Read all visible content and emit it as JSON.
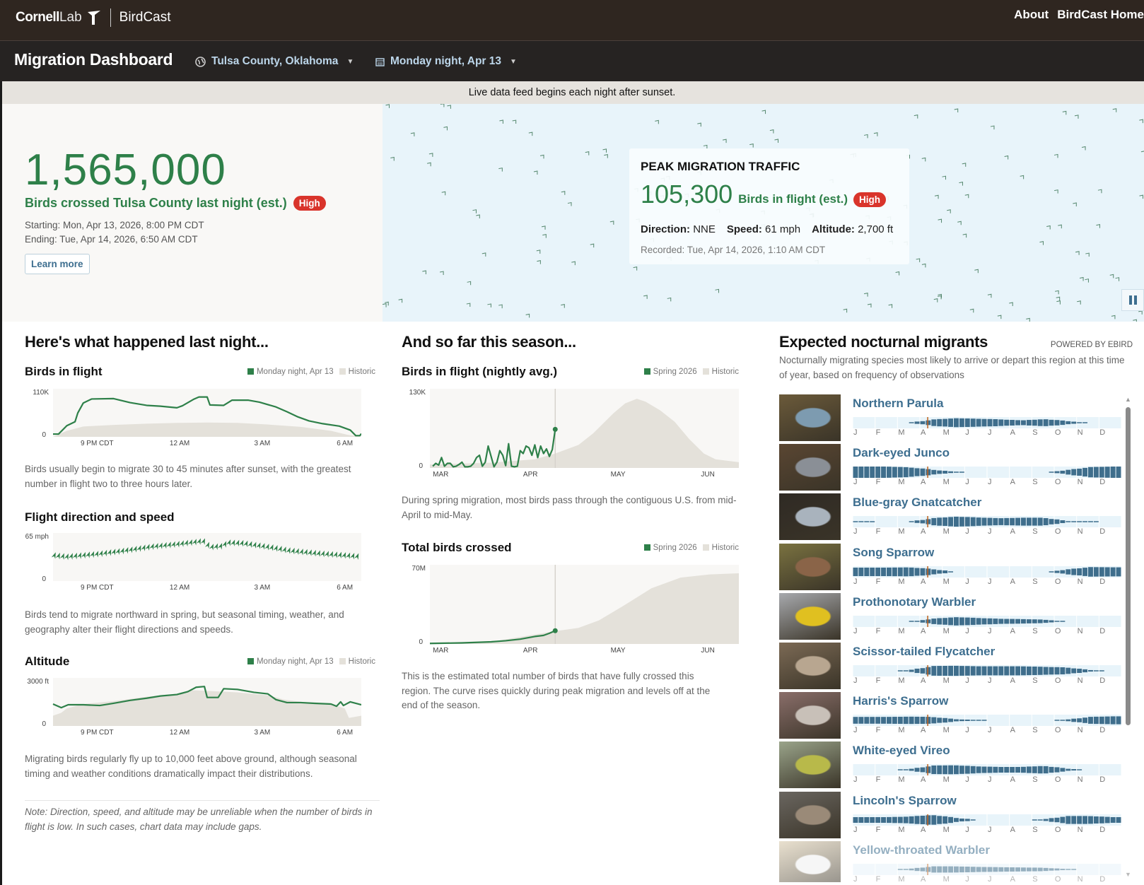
{
  "header": {
    "logo_cornell": "Cornell",
    "logo_lab": "Lab",
    "logo_birdcast": "BirdCast",
    "nav": [
      "About",
      "BirdCast Home"
    ]
  },
  "dashboard": {
    "title": "Migration Dashboard",
    "location": "Tulsa County, Oklahoma",
    "date": "Monday night, Apr 13"
  },
  "notice": "Live data feed begins each night after sunset.",
  "hero": {
    "total": "1,565,000",
    "label": "Birds crossed Tulsa County last night (est.)",
    "badge": "High",
    "starting": "Starting: Mon, Apr 13, 2026, 8:00 PM CDT",
    "ending": "Ending: Tue, Apr 14, 2026, 6:50 AM CDT",
    "learn_more": "Learn more"
  },
  "peak": {
    "title": "PEAK MIGRATION TRAFFIC",
    "number": "105,300",
    "label": "Birds in flight (est.)",
    "badge": "High",
    "direction_label": "Direction:",
    "direction": "NNE",
    "speed_label": "Speed:",
    "speed": "61 mph",
    "altitude_label": "Altitude:",
    "altitude": "2,700 ft",
    "recorded": "Recorded: Tue, Apr 14, 2026, 1:10 AM CDT"
  },
  "colors": {
    "green": "#2e8049",
    "historic": "#e4e1da",
    "badge": "#d9342b",
    "species": "#3d6e8f",
    "bar": "#3f6e8c"
  },
  "last_night": {
    "heading": "Here's what happened last night...",
    "legend_current": "Monday night, Apr 13",
    "legend_historic": "Historic",
    "note": "Note: Direction, speed, and altitude may be unreliable when the number of birds in flight is low. In such cases, chart data may include gaps."
  },
  "season": {
    "heading": "And so far this season...",
    "legend_current": "Spring 2026",
    "legend_historic": "Historic"
  },
  "chart_data": [
    {
      "id": "birds-in-flight",
      "type": "area",
      "title": "Birds in flight",
      "ylabel_top": "110K",
      "ylabel_zero": "0",
      "ylim": [
        0,
        110
      ],
      "xlim": [
        19.4,
        30.6
      ],
      "x_ticks": [
        {
          "x": 21,
          "label": "9 PM CDT"
        },
        {
          "x": 24,
          "label": "12 AM"
        },
        {
          "x": 27,
          "label": "3 AM"
        },
        {
          "x": 30,
          "label": "6 AM"
        }
      ],
      "description": "Birds usually begin to migrate 30 to 45 minutes after sunset, with the greatest number in flight two to three hours later.",
      "historic": [
        [
          19.4,
          0
        ],
        [
          19.9,
          15
        ],
        [
          20.5,
          26
        ],
        [
          21.6,
          30
        ],
        [
          22.8,
          33
        ],
        [
          23.9,
          35
        ],
        [
          25,
          36
        ],
        [
          26.1,
          35
        ],
        [
          27.2,
          31
        ],
        [
          28.4,
          25
        ],
        [
          29.5,
          15
        ],
        [
          30.1,
          5
        ],
        [
          30.6,
          0
        ]
      ],
      "current": [
        [
          19.4,
          7
        ],
        [
          19.6,
          7
        ],
        [
          19.9,
          28
        ],
        [
          20.2,
          38
        ],
        [
          20.3,
          60
        ],
        [
          20.5,
          85
        ],
        [
          20.8,
          95
        ],
        [
          21.6,
          96
        ],
        [
          22.2,
          86
        ],
        [
          22.8,
          79
        ],
        [
          23.3,
          77
        ],
        [
          23.9,
          73
        ],
        [
          24.1,
          78
        ],
        [
          24.5,
          94
        ],
        [
          24.7,
          100
        ],
        [
          25,
          100
        ],
        [
          25.1,
          80
        ],
        [
          25.6,
          79
        ],
        [
          25.9,
          92
        ],
        [
          26.5,
          92
        ],
        [
          26.9,
          87
        ],
        [
          27.5,
          75
        ],
        [
          27.9,
          63
        ],
        [
          28.3,
          50
        ],
        [
          28.7,
          40
        ],
        [
          29.2,
          33
        ],
        [
          29.8,
          27
        ],
        [
          30.2,
          17
        ],
        [
          30.4,
          3
        ],
        [
          30.55,
          3
        ],
        [
          30.6,
          8
        ]
      ]
    },
    {
      "id": "flight-speed",
      "type": "line",
      "title": "Flight direction and speed",
      "ylabel_top": "65 mph",
      "ylabel_zero": "0",
      "ylim": [
        0,
        65
      ],
      "xlim": [
        19.4,
        30.6
      ],
      "direction_deg": 22,
      "x_ticks": [
        {
          "x": 21,
          "label": "9 PM CDT"
        },
        {
          "x": 24,
          "label": "12 AM"
        },
        {
          "x": 27,
          "label": "3 AM"
        },
        {
          "x": 30,
          "label": "6 AM"
        }
      ],
      "description": "Birds tend to migrate northward in spring, but seasonal timing, weather, and geography alter their flight directions and speeds.",
      "current": [
        [
          19.4,
          38
        ],
        [
          19.9,
          36
        ],
        [
          21,
          40
        ],
        [
          22,
          45
        ],
        [
          23,
          51
        ],
        [
          24,
          55
        ],
        [
          24.8,
          59
        ],
        [
          25,
          58
        ],
        [
          25.05,
          50
        ],
        [
          25.6,
          52
        ],
        [
          25.7,
          57
        ],
        [
          26.3,
          56
        ],
        [
          27.3,
          50
        ],
        [
          28,
          45
        ],
        [
          29,
          41
        ],
        [
          30,
          38
        ],
        [
          30.6,
          36
        ]
      ]
    },
    {
      "id": "altitude",
      "type": "area",
      "title": "Altitude",
      "ylabel_top": "3000 ft",
      "ylabel_zero": "0",
      "ylim": [
        0,
        3000
      ],
      "xlim": [
        19.4,
        30.6
      ],
      "x_ticks": [
        {
          "x": 21,
          "label": "9 PM CDT"
        },
        {
          "x": 24,
          "label": "12 AM"
        },
        {
          "x": 27,
          "label": "3 AM"
        },
        {
          "x": 30,
          "label": "6 AM"
        }
      ],
      "description": "Migrating birds regularly fly up to 10,000 feet above ground, although seasonal timing and weather conditions dramatically impact their distributions.",
      "historic": [
        [
          19.4,
          700
        ],
        [
          19.7,
          900
        ],
        [
          19.9,
          1200
        ],
        [
          20.5,
          1500
        ],
        [
          21.6,
          1700
        ],
        [
          22.8,
          2000
        ],
        [
          23.9,
          2200
        ],
        [
          24.4,
          2450
        ],
        [
          25,
          2400
        ],
        [
          26.1,
          2300
        ],
        [
          27.2,
          2100
        ],
        [
          27.8,
          1800
        ],
        [
          28.4,
          1650
        ],
        [
          29.5,
          1500
        ],
        [
          30,
          1200
        ],
        [
          30.15,
          550
        ],
        [
          30.6,
          700
        ]
      ],
      "current": [
        [
          19.4,
          1500
        ],
        [
          19.7,
          1250
        ],
        [
          19.95,
          1450
        ],
        [
          20.5,
          1450
        ],
        [
          21.1,
          1400
        ],
        [
          21.6,
          1550
        ],
        [
          22.2,
          1750
        ],
        [
          22.8,
          1900
        ],
        [
          23.3,
          2050
        ],
        [
          23.9,
          2150
        ],
        [
          24.3,
          2350
        ],
        [
          24.6,
          2650
        ],
        [
          24.9,
          2700
        ],
        [
          25,
          1950
        ],
        [
          25.4,
          1950
        ],
        [
          25.6,
          2550
        ],
        [
          26.1,
          2500
        ],
        [
          26.7,
          2300
        ],
        [
          27.2,
          2200
        ],
        [
          27.5,
          1800
        ],
        [
          27.9,
          1600
        ],
        [
          28.4,
          1600
        ],
        [
          28.9,
          1550
        ],
        [
          29.5,
          1500
        ],
        [
          29.7,
          1350
        ],
        [
          29.85,
          1650
        ],
        [
          29.95,
          1400
        ],
        [
          30.2,
          1650
        ],
        [
          30.6,
          1450
        ]
      ]
    },
    {
      "id": "nightly-avg",
      "type": "area",
      "title": "Birds in flight (nightly avg.)",
      "ylabel_top": "130K",
      "ylabel_zero": "0",
      "ylim": [
        0,
        130
      ],
      "xlim": [
        -1,
        105
      ],
      "current_day": 42,
      "x_ticks": [
        {
          "x": 0,
          "label": "MAR"
        },
        {
          "x": 31,
          "label": "APR"
        },
        {
          "x": 61,
          "label": "MAY"
        },
        {
          "x": 92,
          "label": "JUN"
        }
      ],
      "description": "During spring migration, most birds pass through the contiguous U.S. from mid-April to mid-May.",
      "historic": [
        [
          -1,
          6
        ],
        [
          20,
          9
        ],
        [
          35,
          15
        ],
        [
          42,
          25
        ],
        [
          50,
          40
        ],
        [
          55,
          60
        ],
        [
          62,
          95
        ],
        [
          66,
          112
        ],
        [
          70,
          120
        ],
        [
          73,
          115
        ],
        [
          78,
          100
        ],
        [
          83,
          80
        ],
        [
          88,
          50
        ],
        [
          93,
          25
        ],
        [
          97,
          15
        ],
        [
          105,
          10
        ]
      ],
      "current": [
        [
          0,
          3
        ],
        [
          1,
          8
        ],
        [
          2,
          5
        ],
        [
          3,
          18
        ],
        [
          4,
          3
        ],
        [
          5,
          8
        ],
        [
          6,
          8
        ],
        [
          7,
          2
        ],
        [
          8,
          3
        ],
        [
          9,
          6
        ],
        [
          10,
          10
        ],
        [
          11,
          2
        ],
        [
          12,
          2
        ],
        [
          13,
          3
        ],
        [
          14,
          8
        ],
        [
          15,
          18
        ],
        [
          16,
          22
        ],
        [
          17,
          3
        ],
        [
          18,
          10
        ],
        [
          19,
          38
        ],
        [
          20,
          20
        ],
        [
          21,
          2
        ],
        [
          22,
          10
        ],
        [
          23,
          30
        ],
        [
          24,
          22
        ],
        [
          25,
          4
        ],
        [
          26,
          42
        ],
        [
          27,
          3
        ],
        [
          28,
          2
        ],
        [
          29,
          3
        ],
        [
          30,
          30
        ],
        [
          31,
          25
        ],
        [
          32,
          38
        ],
        [
          33,
          35
        ],
        [
          34,
          22
        ],
        [
          35,
          40
        ],
        [
          36,
          18
        ],
        [
          37,
          38
        ],
        [
          38,
          25
        ],
        [
          39,
          33
        ],
        [
          40,
          20
        ],
        [
          41,
          32
        ],
        [
          42,
          67
        ]
      ]
    },
    {
      "id": "total-crossed",
      "type": "area",
      "title": "Total birds crossed",
      "ylabel_top": "70M",
      "ylabel_zero": "0",
      "ylim": [
        0,
        70
      ],
      "xlim": [
        -1,
        105
      ],
      "current_day": 42,
      "x_ticks": [
        {
          "x": 0,
          "label": "MAR"
        },
        {
          "x": 31,
          "label": "APR"
        },
        {
          "x": 61,
          "label": "MAY"
        },
        {
          "x": 92,
          "label": "JUN"
        }
      ],
      "description": "This is the estimated total number of birds that have fully crossed this region. The curve rises quickly during peak migration and levels off at the end of the season.",
      "historic": [
        [
          -1,
          0.5
        ],
        [
          20,
          2
        ],
        [
          42,
          12
        ],
        [
          50,
          15
        ],
        [
          57,
          22
        ],
        [
          65,
          35
        ],
        [
          75,
          52
        ],
        [
          85,
          62
        ],
        [
          95,
          65
        ],
        [
          105,
          66
        ]
      ],
      "current": [
        [
          -1,
          0.5
        ],
        [
          10,
          1
        ],
        [
          20,
          2
        ],
        [
          25,
          3
        ],
        [
          30,
          4.5
        ],
        [
          35,
          7
        ],
        [
          38,
          8
        ],
        [
          40,
          10
        ],
        [
          42,
          12.4
        ]
      ]
    }
  ],
  "migrants": {
    "heading": "Expected nocturnal migrants",
    "powered_by": "POWERED BY EBIRD",
    "description": "Nocturnally migrating species most likely to arrive or depart this region at this time of year, based on frequency of observations",
    "months": [
      "J",
      "F",
      "M",
      "A",
      "M",
      "J",
      "J",
      "A",
      "S",
      "O",
      "N",
      "D"
    ],
    "current_week": 13.4,
    "species": [
      {
        "name": "Northern Parula",
        "photo": [
          "#6b5a3a",
          "#7d9bb0"
        ],
        "freq": [
          0,
          0,
          0,
          0.55,
          0.8,
          0.7,
          0.6,
          0.4,
          0.65,
          0.3,
          0,
          0
        ]
      },
      {
        "name": "Dark-eyed Junco",
        "photo": [
          "#5a4632",
          "#8a8f96"
        ],
        "freq": [
          1,
          1,
          0.85,
          0.45,
          0.05,
          0,
          0,
          0,
          0,
          0.35,
          0.9,
          1
        ]
      },
      {
        "name": "Blue-gray Gnatcatcher",
        "photo": [
          "#2f2a24",
          "#a9b3bd"
        ],
        "freq": [
          0.05,
          0,
          0,
          0.6,
          0.9,
          0.75,
          0.6,
          0.7,
          0.7,
          0.1,
          0.05,
          0
        ]
      },
      {
        "name": "Song Sparrow",
        "photo": [
          "#7a7240",
          "#8a6448"
        ],
        "freq": [
          0.75,
          0.75,
          0.8,
          0.5,
          0,
          0,
          0,
          0,
          0,
          0.4,
          0.85,
          0.8
        ]
      },
      {
        "name": "Prothonotary Warbler",
        "photo": [
          "#a7a9ad",
          "#e0c020"
        ],
        "freq": [
          0,
          0,
          0,
          0.45,
          0.75,
          0.6,
          0.45,
          0.4,
          0.3,
          0,
          0,
          0
        ]
      },
      {
        "name": "Scissor-tailed Flycatcher",
        "photo": [
          "#7c6a55",
          "#b8a690"
        ],
        "freq": [
          0,
          0,
          0.1,
          0.85,
          0.9,
          0.8,
          0.8,
          0.8,
          0.7,
          0.6,
          0.15,
          0
        ]
      },
      {
        "name": "Harris's Sparrow",
        "photo": [
          "#8a6e6a",
          "#c8c0b8"
        ],
        "freq": [
          0.6,
          0.6,
          0.65,
          0.6,
          0.2,
          0.05,
          0,
          0,
          0,
          0.1,
          0.6,
          0.7
        ]
      },
      {
        "name": "White-eyed Vireo",
        "photo": [
          "#9aa48a",
          "#b8b94a"
        ],
        "freq": [
          0,
          0,
          0.1,
          0.75,
          0.8,
          0.6,
          0.5,
          0.5,
          0.7,
          0.2,
          0,
          0
        ]
      },
      {
        "name": "Lincoln's Sparrow",
        "photo": [
          "#6a6660",
          "#9a8a78"
        ],
        "freq": [
          0.5,
          0.5,
          0.6,
          0.9,
          0.4,
          0,
          0,
          0,
          0.1,
          0.7,
          0.7,
          0.5
        ]
      },
      {
        "name": "Yellow-throated Warbler",
        "photo": [
          "#d8c8a8",
          "#f0f0f0"
        ],
        "freq": [
          0,
          0,
          0.1,
          0.55,
          0.55,
          0.45,
          0.4,
          0.35,
          0.3,
          0.05,
          0,
          0
        ]
      }
    ]
  }
}
